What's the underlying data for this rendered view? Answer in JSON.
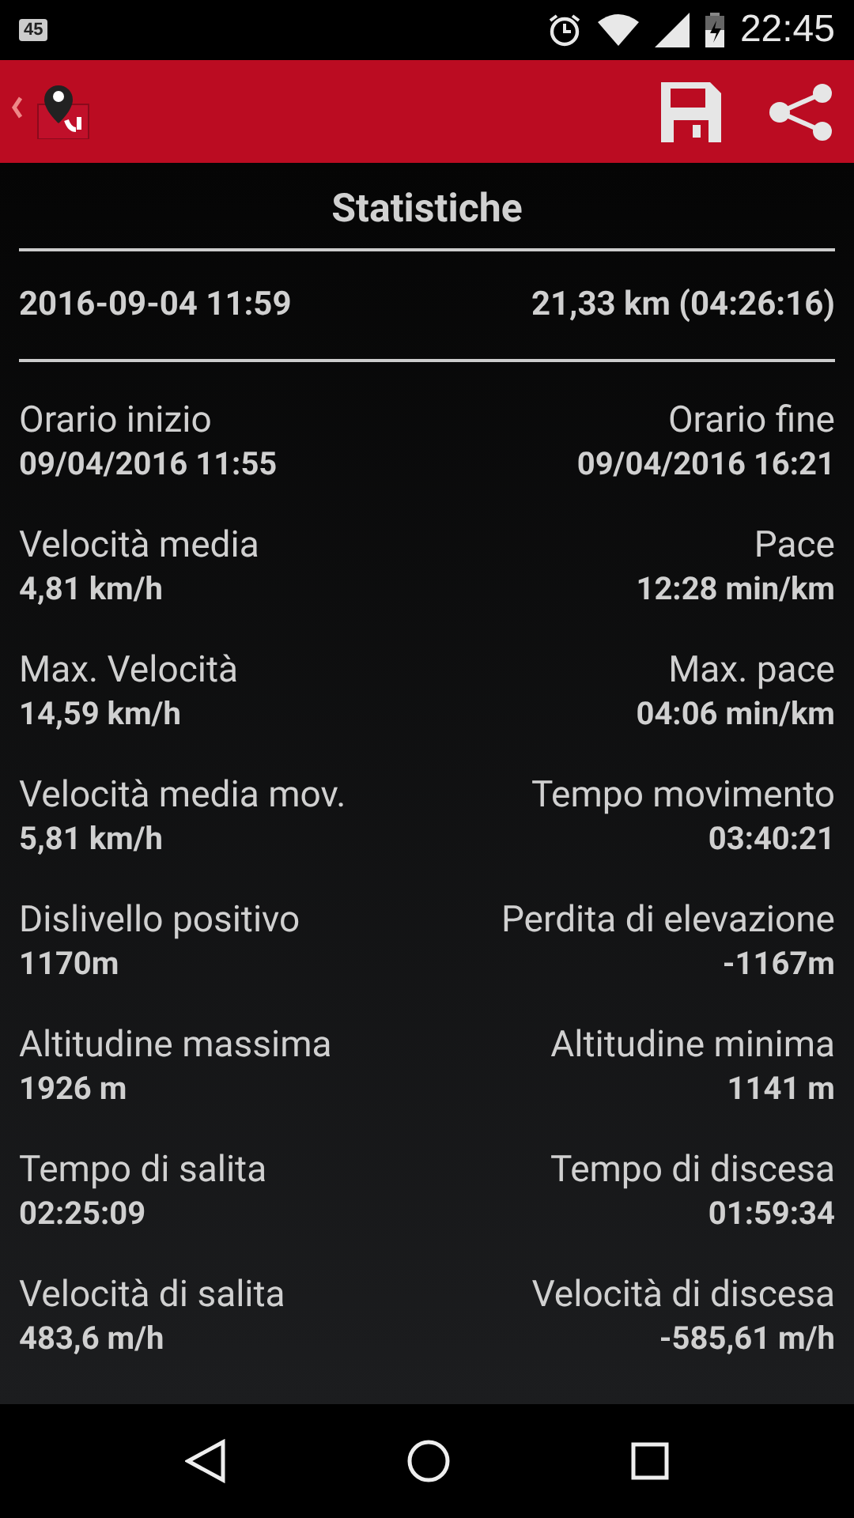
{
  "status_bar": {
    "notification_badge": "45",
    "time": "22:45"
  },
  "title": "Statistiche",
  "summary": {
    "date": "2016-09-04 11:59",
    "distance": "21,33 km (04:26:16)"
  },
  "stats": [
    {
      "left": {
        "label": "Orario inizio",
        "value": "09/04/2016 11:55"
      },
      "right": {
        "label": "Orario fine",
        "value": "09/04/2016 16:21"
      }
    },
    {
      "left": {
        "label": "Velocità media",
        "value": "4,81 km/h"
      },
      "right": {
        "label": "Pace",
        "value": "12:28 min/km"
      }
    },
    {
      "left": {
        "label": "Max. Velocità",
        "value": "14,59 km/h"
      },
      "right": {
        "label": "Max. pace",
        "value": "04:06 min/km"
      }
    },
    {
      "left": {
        "label": "Velocità media mov.",
        "value": "5,81 km/h"
      },
      "right": {
        "label": "Tempo movimento",
        "value": "03:40:21"
      }
    },
    {
      "left": {
        "label": "Dislivello positivo",
        "value": "1170m"
      },
      "right": {
        "label": "Perdita di elevazione",
        "value": "-1167m"
      }
    },
    {
      "left": {
        "label": "Altitudine massima",
        "value": "1926 m"
      },
      "right": {
        "label": "Altitudine minima",
        "value": "1141 m"
      }
    },
    {
      "left": {
        "label": "Tempo di salita",
        "value": "02:25:09"
      },
      "right": {
        "label": "Tempo di discesa",
        "value": "01:59:34"
      }
    },
    {
      "left": {
        "label": "Velocità di salita",
        "value": "483,6 m/h"
      },
      "right": {
        "label": "Velocità di discesa",
        "value": "-585,61 m/h"
      }
    }
  ]
}
